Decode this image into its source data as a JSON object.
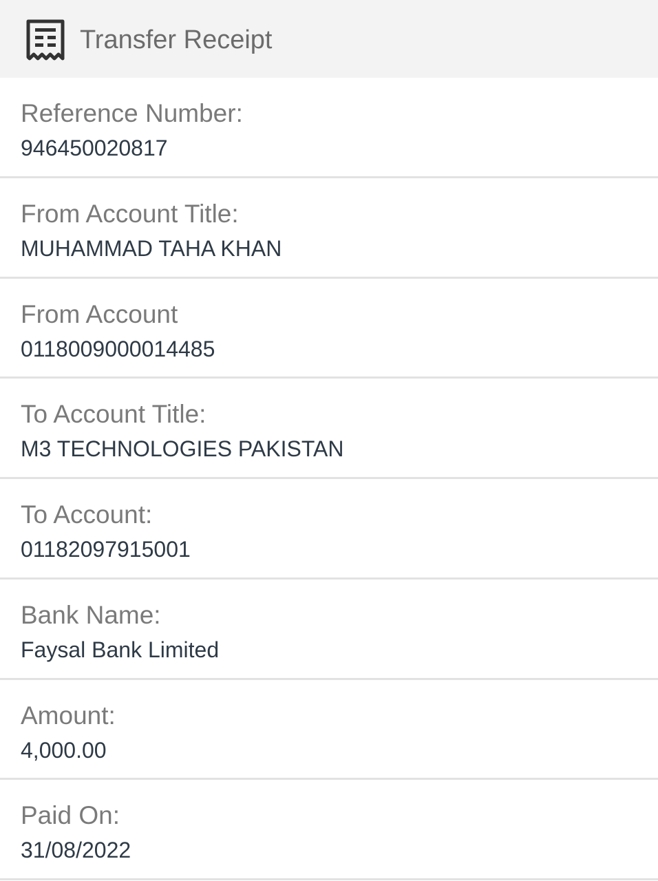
{
  "header": {
    "icon": "receipt-icon",
    "title": "Transfer Receipt"
  },
  "rows": [
    {
      "label": "Reference Number:",
      "value": "946450020817"
    },
    {
      "label": "From Account Title:",
      "value": "MUHAMMAD TAHA KHAN"
    },
    {
      "label": "From Account",
      "value": "0118009000014485"
    },
    {
      "label": "To Account Title:",
      "value": "M3 TECHNOLOGIES PAKISTAN"
    },
    {
      "label": "To Account:",
      "value": "01182097915001"
    },
    {
      "label": "Bank Name:",
      "value": "Faysal Bank Limited"
    },
    {
      "label": "Amount:",
      "value": "4,000.00"
    },
    {
      "label": "Paid On:",
      "value": "31/08/2022"
    }
  ]
}
